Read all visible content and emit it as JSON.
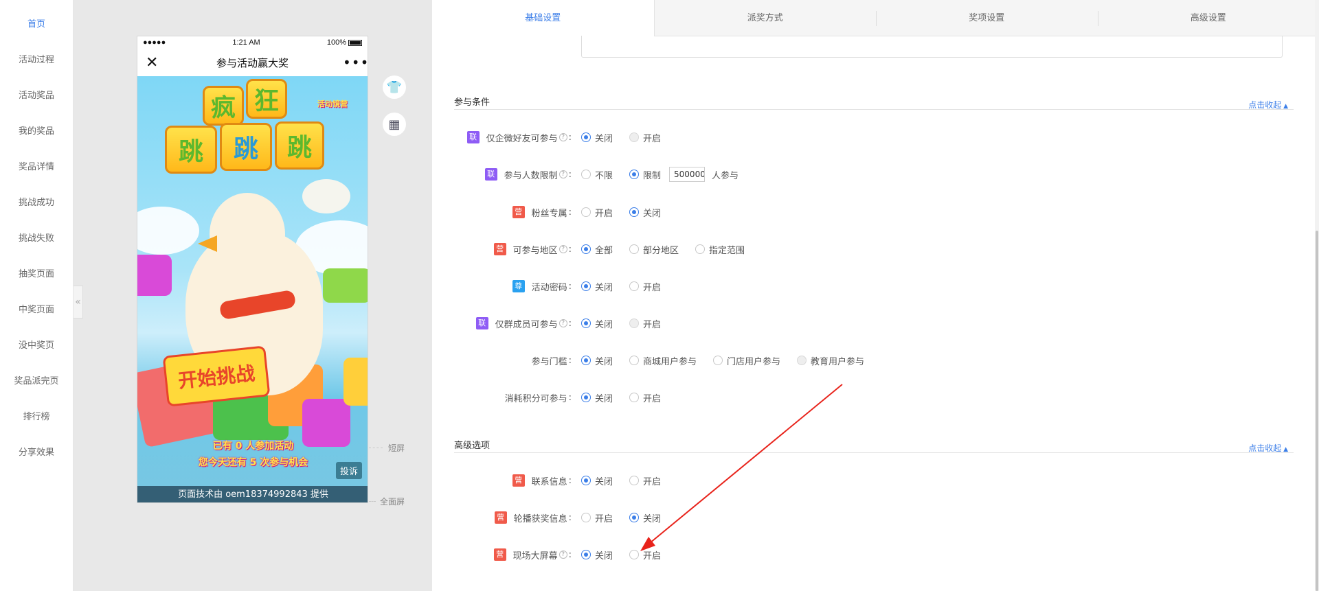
{
  "nav": {
    "items": [
      {
        "label": "首页",
        "active": true
      },
      {
        "label": "活动过程"
      },
      {
        "label": "活动奖品"
      },
      {
        "label": "我的奖品"
      },
      {
        "label": "奖品详情"
      },
      {
        "label": "挑战成功"
      },
      {
        "label": "挑战失败"
      },
      {
        "label": "抽奖页面"
      },
      {
        "label": "中奖页面"
      },
      {
        "label": "没中奖页"
      },
      {
        "label": "奖品派完页"
      },
      {
        "label": "排行榜"
      },
      {
        "label": "分享效果"
      }
    ],
    "collapse_glyph": "«"
  },
  "phone": {
    "signal": "●●●●●",
    "time": "1:21 AM",
    "battery": "100%",
    "title": "参与活动赢大奖",
    "close_glyph": "✕",
    "more_glyph": "•••",
    "game": {
      "title_blocks": [
        "疯",
        "狂",
        "跳",
        "跳",
        "跳"
      ],
      "badge": "活动镜营",
      "banner_text": "开始挑战",
      "line1": "已有 0 人参加活动",
      "line2": "您今天还有 5 次参与机会",
      "complaint": "投诉",
      "footer": "页面技术由 oem18374992843 提供"
    }
  },
  "preview_tools": {
    "shirt_icon": "👕",
    "grid_icon": "▦",
    "short_screen": "短屏",
    "full_screen": "全面屏"
  },
  "tabs": [
    {
      "label": "基础设置",
      "active": true
    },
    {
      "label": "派奖方式"
    },
    {
      "label": "奖项设置"
    },
    {
      "label": "高级设置"
    }
  ],
  "sections": {
    "conditions": {
      "title": "参与条件",
      "toggle": "点击收起"
    },
    "advanced": {
      "title": "高级选项",
      "toggle": "点击收起"
    }
  },
  "rows": {
    "enterprise_friend": {
      "tag": "联",
      "label": "仅企微好友可参与",
      "opts": [
        "关闭",
        "开启"
      ]
    },
    "participant_limit": {
      "tag": "联",
      "label": "参与人数限制",
      "opts": [
        "不限",
        "限制"
      ],
      "value": "500000",
      "suffix": "人参与"
    },
    "fans_only": {
      "tag": "营",
      "label": "粉丝专属",
      "opts": [
        "开启",
        "关闭"
      ]
    },
    "region": {
      "tag": "营",
      "label": "可参与地区",
      "opts": [
        "全部",
        "部分地区",
        "指定范围"
      ]
    },
    "password": {
      "tag": "尊",
      "label": "活动密码",
      "opts": [
        "关闭",
        "开启"
      ]
    },
    "group_member": {
      "tag": "联",
      "label": "仅群成员可参与",
      "opts": [
        "关闭",
        "开启"
      ]
    },
    "threshold": {
      "label": "参与门槛",
      "opts": [
        "关闭",
        "商城用户参与",
        "门店用户参与",
        "教育用户参与"
      ]
    },
    "points": {
      "label": "消耗积分可参与",
      "opts": [
        "关闭",
        "开启"
      ]
    },
    "contact": {
      "tag": "营",
      "label": "联系信息",
      "opts": [
        "关闭",
        "开启"
      ]
    },
    "carousel": {
      "tag": "营",
      "label": "轮播获奖信息",
      "opts": [
        "开启",
        "关闭"
      ]
    },
    "big_screen": {
      "tag": "营",
      "label": "现场大屏幕",
      "opts": [
        "关闭",
        "开启"
      ]
    }
  },
  "colors": {
    "accent": "#3b7ee8",
    "tag_lian": "#8e5cf5",
    "tag_ying": "#f05a4a",
    "tag_zun": "#2aa1f0",
    "arrow": "#e8231b"
  }
}
